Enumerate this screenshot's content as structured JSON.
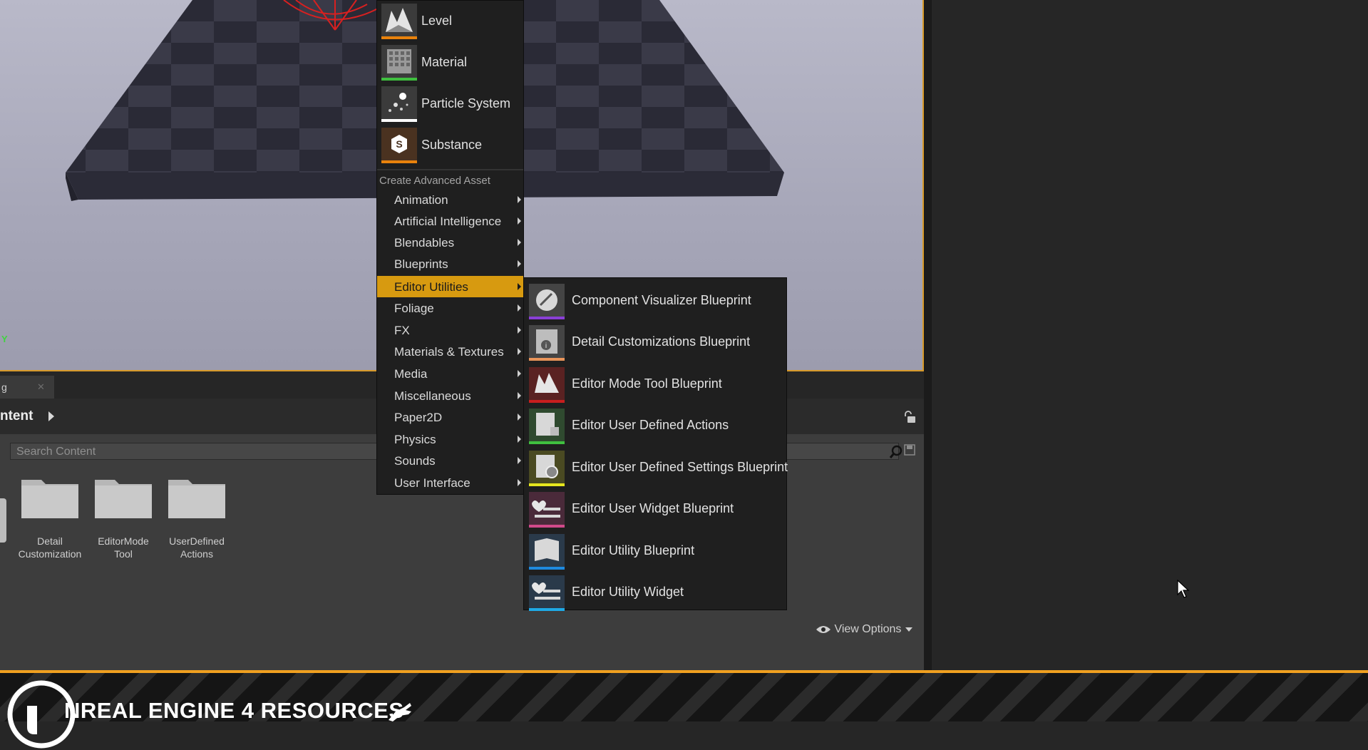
{
  "colors": {
    "accent": "#d79a10",
    "viewport_border": "#d79a2a",
    "banner_stripe": "#f0a020",
    "level_bar": "#e8820c",
    "material_bar": "#3fbf3f",
    "particle_bar": "#ffffff",
    "substance_bar": "#e8820c"
  },
  "viewport": {
    "axis_label": "Y"
  },
  "content_browser": {
    "tab_label": "g",
    "tab_close_icon": "close-icon",
    "path_label": "ntent",
    "search_placeholder": "Search Content",
    "folders": [
      {
        "label": "Detail Customization"
      },
      {
        "label": "EditorMode Tool"
      },
      {
        "label": "UserDefined Actions"
      }
    ],
    "view_options_label": "View Options"
  },
  "menu": {
    "assets": [
      {
        "label": "Level",
        "icon": "level-icon"
      },
      {
        "label": "Material",
        "icon": "material-icon"
      },
      {
        "label": "Particle System",
        "icon": "particle-system-icon"
      },
      {
        "label": "Substance",
        "icon": "substance-icon"
      }
    ],
    "advanced_header": "Create Advanced Asset",
    "advanced_items": [
      {
        "label": "Animation"
      },
      {
        "label": "Artificial Intelligence"
      },
      {
        "label": "Blendables"
      },
      {
        "label": "Blueprints"
      },
      {
        "label": "Editor Utilities",
        "active": true
      },
      {
        "label": "Foliage"
      },
      {
        "label": "FX"
      },
      {
        "label": "Materials & Textures"
      },
      {
        "label": "Media"
      },
      {
        "label": "Miscellaneous"
      },
      {
        "label": "Paper2D"
      },
      {
        "label": "Physics"
      },
      {
        "label": "Sounds"
      },
      {
        "label": "User Interface"
      }
    ]
  },
  "submenu": {
    "items": [
      {
        "label": "Component Visualizer Blueprint",
        "icon": "component-visualizer-icon",
        "color": "#8a3fd6"
      },
      {
        "label": "Detail Customizations Blueprint",
        "icon": "detail-customizations-icon",
        "color": "#e8945a"
      },
      {
        "label": "Editor Mode Tool Blueprint",
        "icon": "editor-mode-tool-icon",
        "color": "#c81e1e"
      },
      {
        "label": "Editor User Defined Actions",
        "icon": "user-defined-actions-icon",
        "color": "#3fbf3f"
      },
      {
        "label": "Editor User Defined Settings Blueprint",
        "icon": "user-defined-settings-icon",
        "color": "#e6e61e"
      },
      {
        "label": "Editor User Widget Blueprint",
        "icon": "user-widget-icon",
        "color": "#d04a8a"
      },
      {
        "label": "Editor Utility Blueprint",
        "icon": "utility-blueprint-icon",
        "color": "#1e8ae0"
      },
      {
        "label": "Editor Utility Widget",
        "icon": "utility-widget-icon",
        "color": "#1eaae6"
      }
    ]
  },
  "banner": {
    "text": "NREAL ENGINE 4 RESOURCES"
  }
}
